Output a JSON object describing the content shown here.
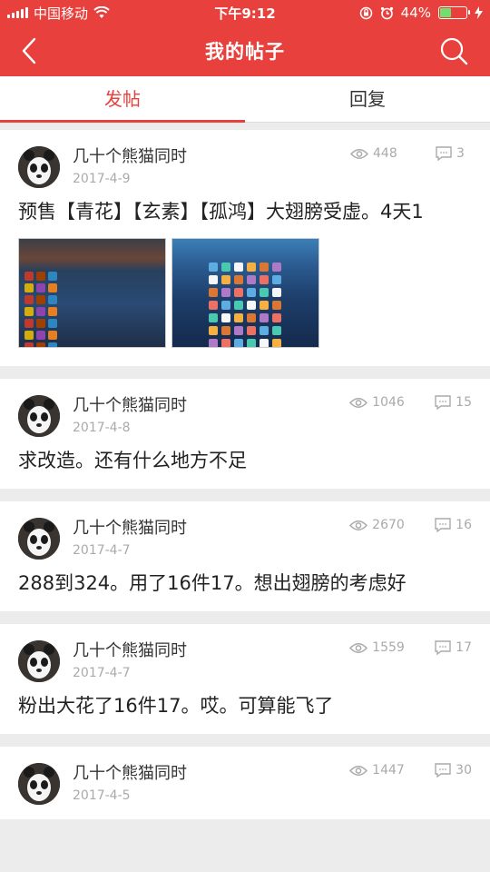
{
  "status": {
    "carrier": "中国移动",
    "time": "下午9:12",
    "battery": "44%",
    "battery_level": 0.44
  },
  "header": {
    "title": "我的帖子",
    "back_icon": "chevron-left-icon",
    "search_icon": "search-icon"
  },
  "tabs": [
    {
      "label": "发帖",
      "active": true
    },
    {
      "label": "回复",
      "active": false
    }
  ],
  "posts": [
    {
      "author": "几十个熊猫同时",
      "date": "2017-4-9",
      "views": "448",
      "comments": "3",
      "title": "预售【青花】【玄素】【孤鸿】大翅膀受虚。4天1",
      "has_images": true
    },
    {
      "author": "几十个熊猫同时",
      "date": "2017-4-8",
      "views": "1046",
      "comments": "15",
      "title": "求改造。还有什么地方不足"
    },
    {
      "author": "几十个熊猫同时",
      "date": "2017-4-7",
      "views": "2670",
      "comments": "16",
      "title": "288到324。用了16件17。想出翅膀的考虑好"
    },
    {
      "author": "几十个熊猫同时",
      "date": "2017-4-7",
      "views": "1559",
      "comments": "17",
      "title": "粉出大花了16件17。哎。可算能飞了"
    },
    {
      "author": "几十个熊猫同时",
      "date": "2017-4-5",
      "views": "1447",
      "comments": "30",
      "title": ""
    }
  ],
  "colors": {
    "accent": "#e8403c",
    "muted": "#aaaaaa"
  }
}
